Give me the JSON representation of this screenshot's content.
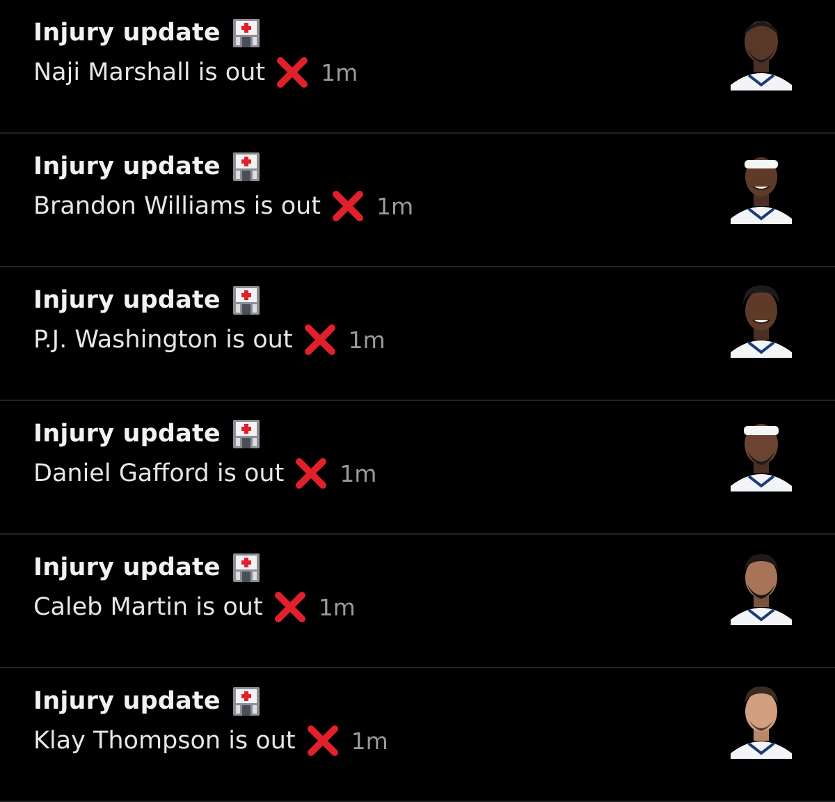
{
  "notifications": [
    {
      "title": "Injury update",
      "message": "Naji Marshall is out",
      "time": "1m",
      "title_icon": "hospital-icon",
      "status_icon": "cross-mark-icon"
    },
    {
      "title": "Injury update",
      "message": "Brandon Williams is out",
      "time": "1m",
      "title_icon": "hospital-icon",
      "status_icon": "cross-mark-icon"
    },
    {
      "title": "Injury update",
      "message": "P.J. Washington is out",
      "time": "1m",
      "title_icon": "hospital-icon",
      "status_icon": "cross-mark-icon"
    },
    {
      "title": "Injury update",
      "message": "Daniel Gafford is out",
      "time": "1m",
      "title_icon": "hospital-icon",
      "status_icon": "cross-mark-icon"
    },
    {
      "title": "Injury update",
      "message": "Caleb Martin is out",
      "time": "1m",
      "title_icon": "hospital-icon",
      "status_icon": "cross-mark-icon"
    },
    {
      "title": "Injury update",
      "message": "Klay Thompson is out",
      "time": "1m",
      "title_icon": "hospital-icon",
      "status_icon": "cross-mark-icon"
    }
  ],
  "colors": {
    "background": "#000000",
    "divider": "#232325",
    "cross": "#e0202a",
    "time": "#9a9a9a"
  }
}
